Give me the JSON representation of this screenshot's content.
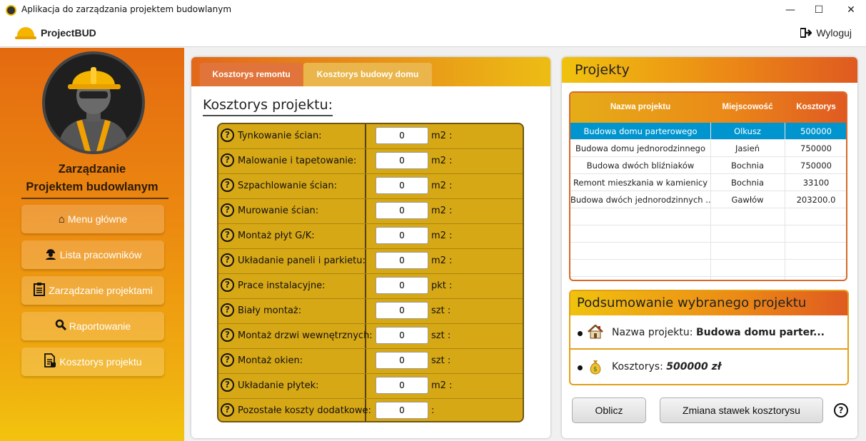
{
  "window": {
    "title": "Aplikacja do zarządzania projektem budowlanym",
    "minimize": "—",
    "maximize": "☐",
    "close": "✕"
  },
  "menubar": {
    "brand": "ProjectBUD",
    "logout": "Wyloguj"
  },
  "sidebar": {
    "heading_line1": "Zarządzanie",
    "heading_line2": "Projektem budowlanym",
    "items": [
      {
        "label": "Menu główne",
        "icon": "home-icon"
      },
      {
        "label": "Lista pracowników",
        "icon": "worker-icon"
      },
      {
        "label": "Zarządzanie projektami",
        "icon": "clipboard-icon"
      },
      {
        "label": "Raportowanie",
        "icon": "search-icon"
      },
      {
        "label": "Kosztorys projektu",
        "icon": "document-icon"
      }
    ]
  },
  "tabs": {
    "active": "Kosztorys remontu",
    "inactive": "Kosztorys budowy domu"
  },
  "estimate": {
    "title": "Kosztorys projektu:",
    "rows": [
      {
        "label": "Tynkowanie ścian:",
        "value": "0",
        "unit": "m2 :"
      },
      {
        "label": "Malowanie i tapetowanie:",
        "value": "0",
        "unit": "m2 :"
      },
      {
        "label": "Szpachlowanie ścian:",
        "value": "0",
        "unit": "m2 :"
      },
      {
        "label": "Murowanie ścian:",
        "value": "0",
        "unit": "m2 :"
      },
      {
        "label": "Montaż płyt G/K:",
        "value": "0",
        "unit": "m2 :"
      },
      {
        "label": "Układanie paneli i parkietu:",
        "value": "0",
        "unit": "m2 :"
      },
      {
        "label": "Prace instalacyjne:",
        "value": "0",
        "unit": "pkt :"
      },
      {
        "label": "Biały montaż:",
        "value": "0",
        "unit": "szt :"
      },
      {
        "label": "Montaż drzwi wewnętrznych:",
        "value": "0",
        "unit": "szt :"
      },
      {
        "label": "Montaż okien:",
        "value": "0",
        "unit": "szt :"
      },
      {
        "label": "Układanie płytek:",
        "value": "0",
        "unit": "m2 :"
      },
      {
        "label": "Pozostałe koszty dodatkowe:",
        "value": "0",
        "unit": ":"
      }
    ]
  },
  "projects": {
    "title": "Projekty",
    "columns": [
      "Nazwa projektu",
      "Miejscowość",
      "Kosztorys"
    ],
    "rows": [
      {
        "name": "Budowa domu parterowego",
        "city": "Olkusz",
        "cost": "500000"
      },
      {
        "name": "Budowa domu jednorodzinnego",
        "city": "Jasień",
        "cost": "750000"
      },
      {
        "name": "Budowa dwóch bliźniaków",
        "city": "Bochnia",
        "cost": "750000"
      },
      {
        "name": "Remont mieszkania w kamienicy",
        "city": "Bochnia",
        "cost": "33100"
      },
      {
        "name": "Budowa dwóch jednorodzinnych ...",
        "city": "Gawłów",
        "cost": "203200.0"
      }
    ]
  },
  "summary": {
    "title": "Podsumowanie wybranego projektu",
    "name_label": "Nazwa projektu:",
    "name_value": "Budowa domu parter...",
    "cost_label": "Kosztorys:",
    "cost_value": "500000 zł"
  },
  "buttons": {
    "calculate": "Oblicz",
    "change_rates": "Zmiana stawek kosztorysu",
    "help": "?"
  },
  "help_glyph": "?"
}
